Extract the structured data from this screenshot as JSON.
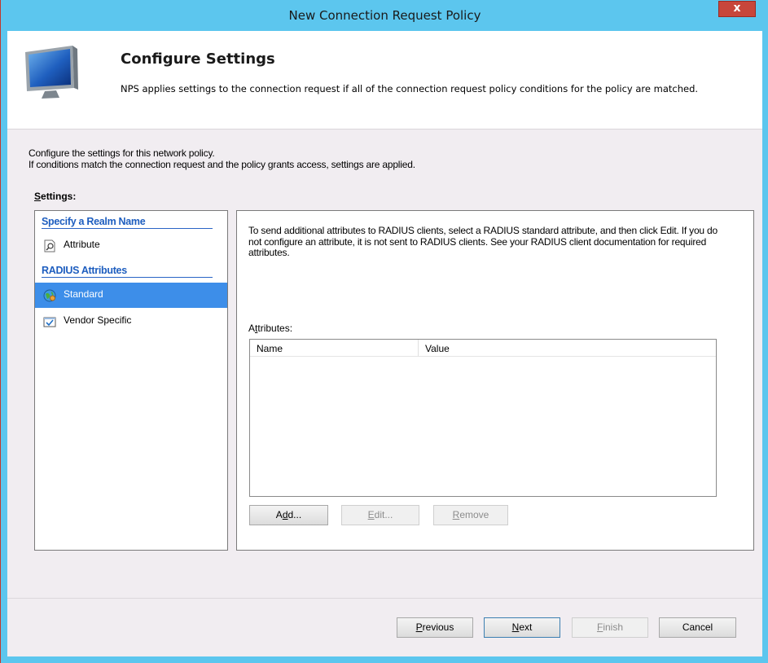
{
  "window": {
    "title": "New Connection Request Policy",
    "close_label": "x"
  },
  "header": {
    "title": "Configure Settings",
    "description": "NPS applies settings to the connection request if all of the connection request policy conditions  for the policy are matched."
  },
  "intro": {
    "line1": "Configure the settings for this network policy.",
    "line2": "If conditions match the connection request and the policy grants access, settings are applied."
  },
  "settings": {
    "label_mnemonic": "S",
    "label_rest": "ettings:"
  },
  "nav": {
    "sections": [
      {
        "title": "Specify a Realm Name",
        "items": [
          {
            "label": "Attribute",
            "icon": "attribute-icon"
          }
        ]
      },
      {
        "title": "RADIUS Attributes",
        "items": [
          {
            "label": "Standard",
            "icon": "globe-icon",
            "selected": true
          },
          {
            "label": "Vendor Specific",
            "icon": "checkbox-window-icon"
          }
        ]
      }
    ]
  },
  "panel": {
    "description": "To send additional attributes to RADIUS clients, select a RADIUS standard attribute, and then click Edit. If you do not configure an attribute, it is not sent to RADIUS clients. See your RADIUS client documentation for required attributes.",
    "attributes_label_mnemonic": "t",
    "attributes_label_pre": "A",
    "attributes_label_post": "tributes:",
    "columns": [
      "Name",
      "Value"
    ],
    "rows": [],
    "buttons": {
      "add": {
        "mnemonic": "d",
        "pre": "A",
        "post": "d...",
        "enabled": true
      },
      "edit": {
        "mnemonic": "E",
        "pre": "",
        "post": "dit...",
        "enabled": false
      },
      "remove": {
        "mnemonic": "R",
        "pre": "",
        "post": "emove",
        "enabled": false
      }
    }
  },
  "footer": {
    "previous": {
      "mnemonic": "P",
      "post": "revious"
    },
    "next": {
      "mnemonic": "N",
      "post": "ext"
    },
    "finish": {
      "mnemonic": "F",
      "post": "inish"
    },
    "cancel": "Cancel"
  },
  "colors": {
    "title_bar": "#5cc6ee",
    "selection": "#3d8ee9",
    "section_heading": "#1e5ebf",
    "close_button": "#c7463b"
  }
}
